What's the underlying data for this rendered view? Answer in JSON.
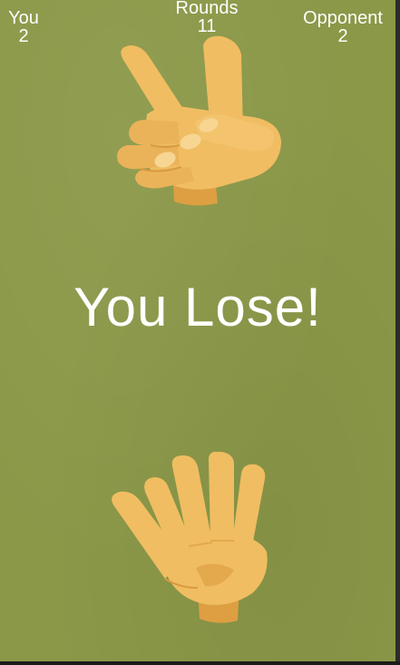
{
  "scoreboard": {
    "you": {
      "label": "You",
      "value": "2"
    },
    "rounds": {
      "label": "Rounds",
      "value": "11"
    },
    "opponent": {
      "label": "Opponent",
      "value": "2"
    }
  },
  "result_text": "You Lose!",
  "opponent_hand": {
    "icon": "scissors-hand-icon",
    "move": "scissors"
  },
  "player_hand": {
    "icon": "paper-hand-icon",
    "move": "paper"
  },
  "colors": {
    "background": "#8b9848",
    "skin": "#f0bd62",
    "skin_shadow": "#dd9f42",
    "text": "#ffffff"
  }
}
